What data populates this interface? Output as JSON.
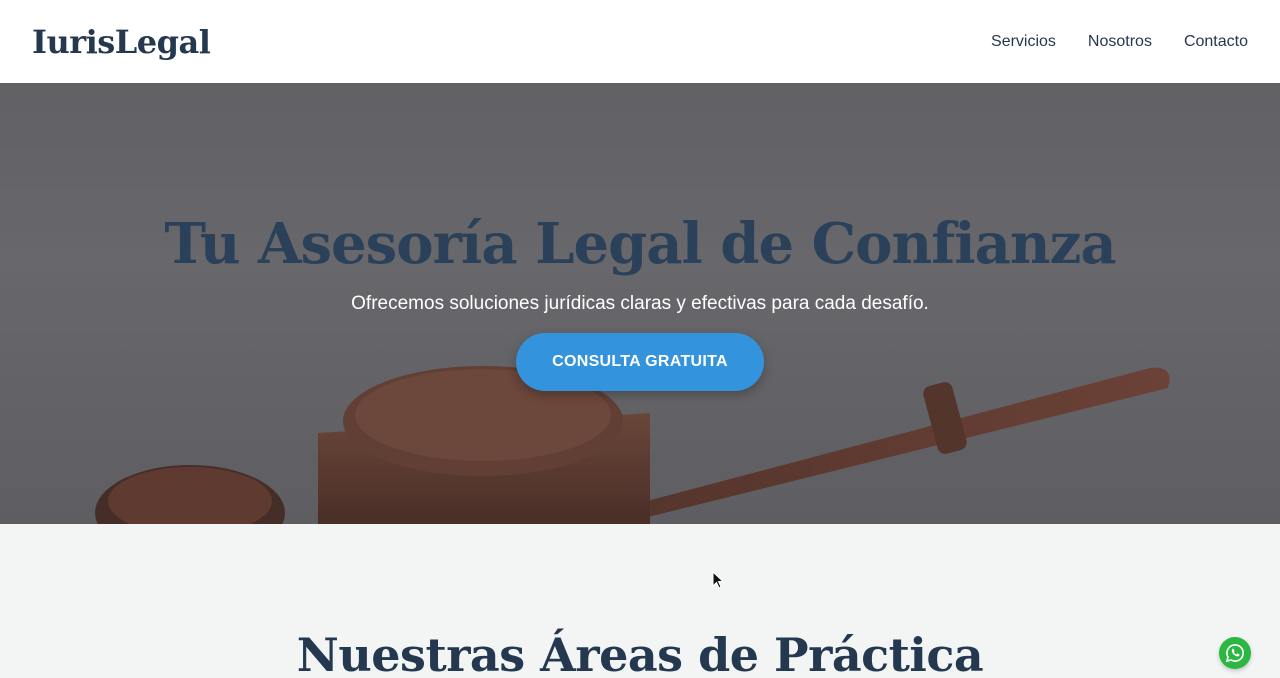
{
  "brand": {
    "logo": "IurisLegal"
  },
  "nav": {
    "items": [
      "Servicios",
      "Nosotros",
      "Contacto"
    ]
  },
  "hero": {
    "title": "Tu Asesoría Legal de Confianza",
    "subtitle": "Ofrecemos soluciones jurídicas claras y efectivas para cada desafío.",
    "cta_label": "CONSULTA GRATUITA"
  },
  "practice": {
    "title": "Nuestras Áreas de Práctica"
  },
  "colors": {
    "brand_dark": "#24384f",
    "accent": "#3393dc",
    "whatsapp": "#2bb741"
  },
  "icons": {
    "floating": "whatsapp-icon",
    "pointer": "mouse-cursor-icon"
  }
}
